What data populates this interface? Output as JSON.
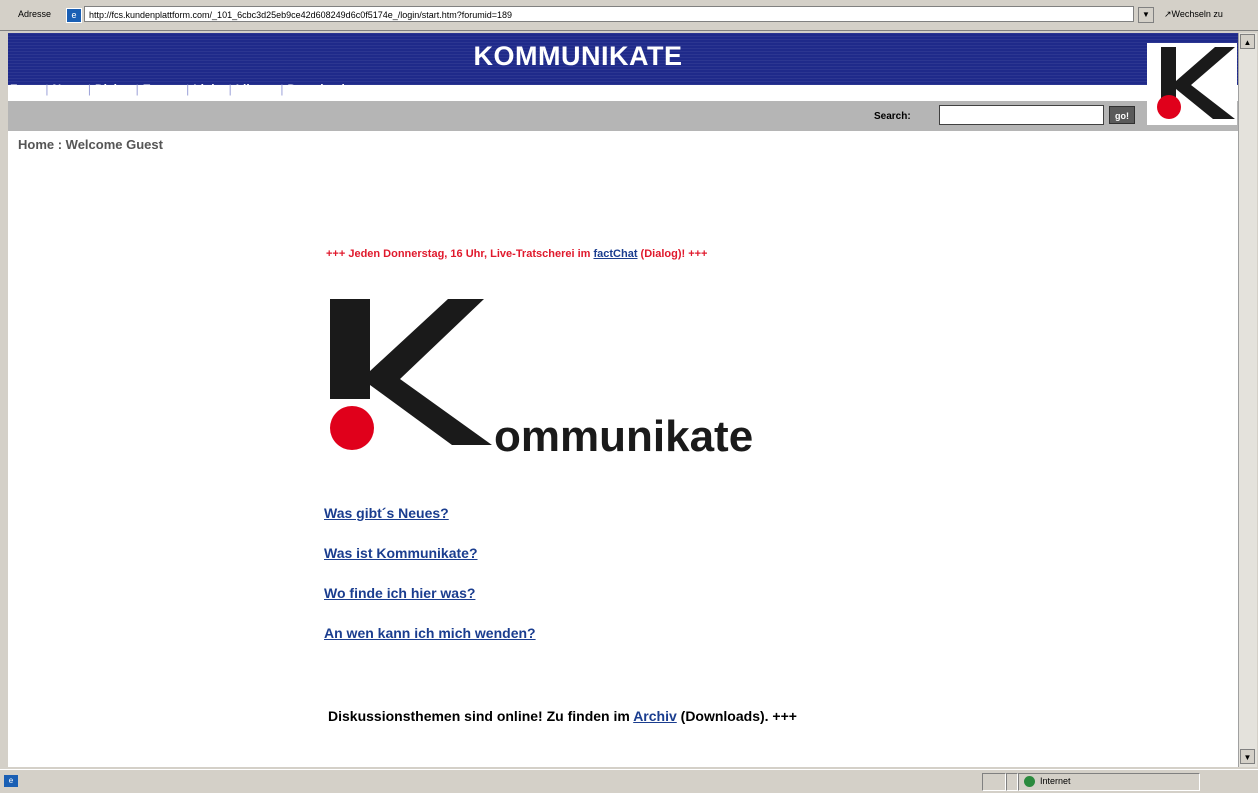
{
  "address": {
    "label": "Adresse",
    "url": "http://fcs.kundenplattform.com/_101_6cbc3d25eb9ce42d608249d6c0f5174e_/login/start.htm?forumid=189",
    "go_label": "Wechseln zu"
  },
  "header": {
    "title": "KOMMUNIKATE",
    "nav": [
      "Facts",
      "News",
      "Dialog",
      "Events",
      "Links",
      "Library",
      "Downloads"
    ],
    "login": "Login"
  },
  "search": {
    "label": "Search:",
    "button": "go!"
  },
  "breadcrumb": "Home : Welcome Guest",
  "announcement": {
    "prefix": "+++ Jeden Donnerstag, 16 Uhr, Live-Tratscherei im ",
    "link": "factChat",
    "suffix": " (Dialog)! +++"
  },
  "logo": {
    "wordmark": "ommunikate",
    "colors": {
      "black": "#1a1a1a",
      "red": "#e0001b"
    }
  },
  "links": [
    "Was gibt´s Neues?",
    "Was ist Kommunikate?",
    "Wo finde ich hier was?",
    "An wen kann ich mich wenden?"
  ],
  "footer": {
    "prefix": "Diskussionsthemen sind online! Zu finden im ",
    "link": "Archiv",
    "suffix": " (Downloads). +++"
  },
  "status": {
    "zone": "Internet"
  },
  "colors": {
    "header_blue": "#1f2a8a",
    "link_blue": "#1a3d8f",
    "announce_red": "#e0192c"
  }
}
